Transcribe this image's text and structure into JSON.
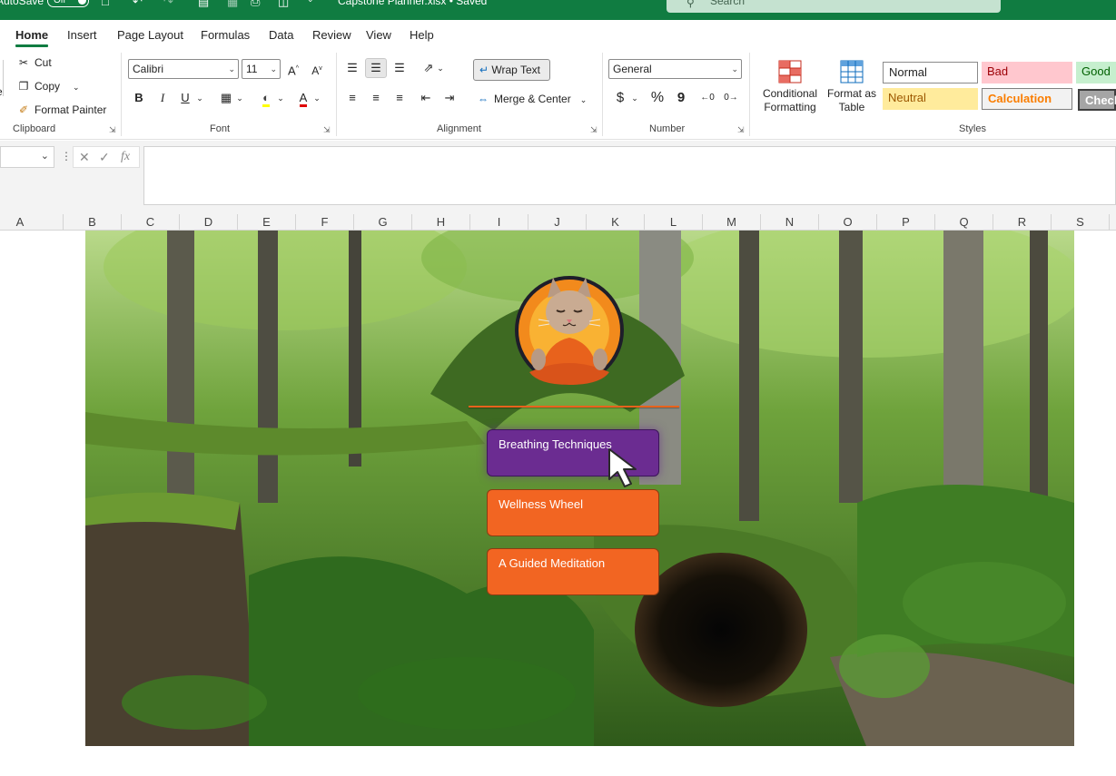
{
  "titlebar": {
    "autosave_label": "AutoSave",
    "autosave_state": "Off",
    "document_name": "Capstone Planner.xlsx • Saved",
    "search_placeholder": "Search"
  },
  "menu": {
    "tabs": [
      "Home",
      "Insert",
      "Page Layout",
      "Formulas",
      "Data",
      "Review",
      "View",
      "Help"
    ],
    "active": "Home"
  },
  "ribbon": {
    "clipboard": {
      "cut": "Cut",
      "copy": "Copy",
      "format_painter": "Format Painter",
      "label": "Clipboard"
    },
    "font": {
      "name": "Calibri",
      "size": "11",
      "bold": "B",
      "italic": "I",
      "underline": "U",
      "label": "Font"
    },
    "alignment": {
      "wrap_text": "Wrap Text",
      "merge_center": "Merge & Center",
      "label": "Alignment"
    },
    "number": {
      "format": "General",
      "currency": "$",
      "percent": "%",
      "comma": "9",
      "label": "Number"
    },
    "conditional_formatting": "Conditional Formatting",
    "format_as_table": "Format as Table",
    "styles": {
      "normal": "Normal",
      "bad": "Bad",
      "good": "Good",
      "neutral": "Neutral",
      "calculation": "Calculation",
      "check": "Check",
      "label": "Styles"
    }
  },
  "formula_bar": {
    "name_box": "",
    "fx": "fx",
    "formula": ""
  },
  "columns": [
    "A",
    "B",
    "C",
    "D",
    "E",
    "F",
    "G",
    "H",
    "I",
    "J",
    "K",
    "L",
    "M",
    "N",
    "O",
    "P",
    "Q",
    "R",
    "S"
  ],
  "sheet": {
    "buttons": [
      {
        "label": "Breathing Techniques",
        "color": "#6b2c91"
      },
      {
        "label": "Wellness Wheel",
        "color": "#f26522"
      },
      {
        "label": "A Guided Meditation",
        "color": "#f26522"
      }
    ],
    "accent_color": "#107c41"
  }
}
